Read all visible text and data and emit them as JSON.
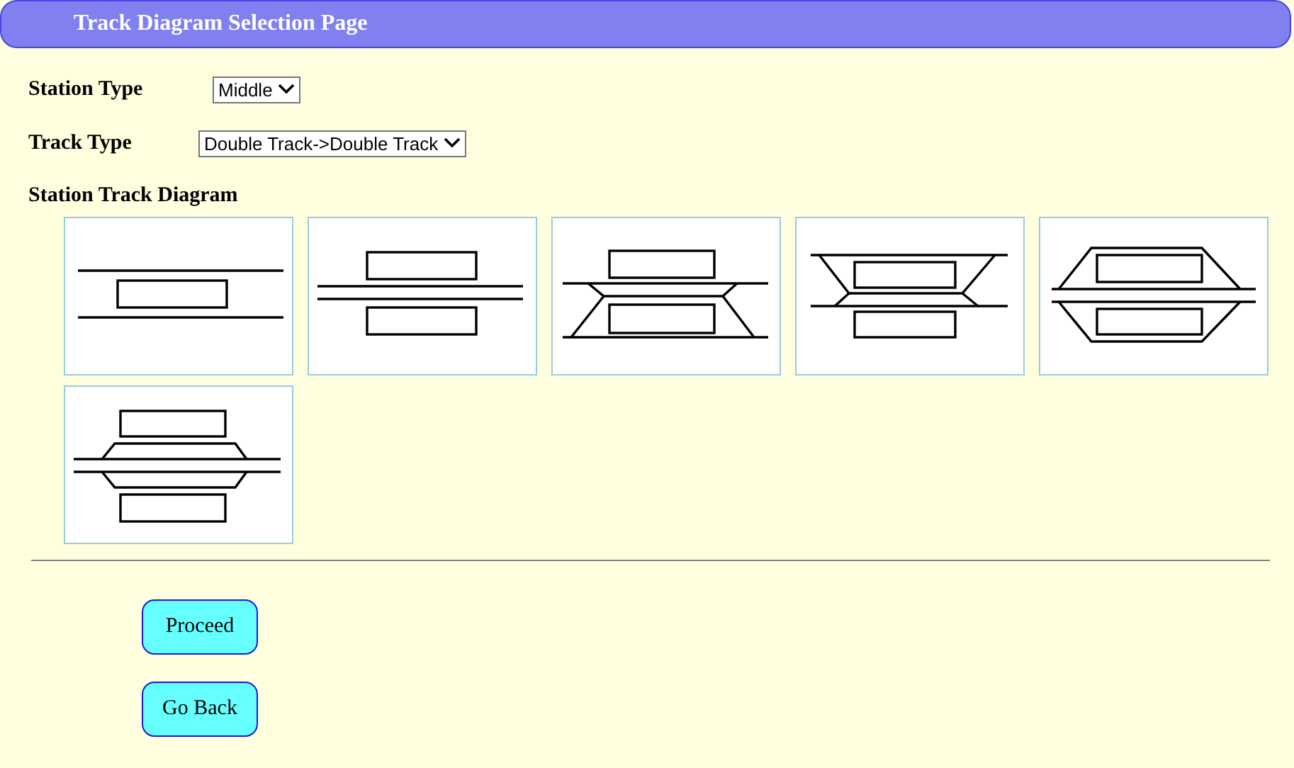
{
  "header": {
    "title": "Track Diagram Selection Page"
  },
  "fields": [
    {
      "label": "Station Type",
      "value": "Middle"
    },
    {
      "label": "Track Type",
      "value": "Double Track->Double Track"
    }
  ],
  "diagram_section": {
    "title": "Station Track Diagram",
    "diagrams": [
      {
        "kind": "single-island"
      },
      {
        "kind": "double-main"
      },
      {
        "kind": "loop-below"
      },
      {
        "kind": "loop-between"
      },
      {
        "kind": "loop-outer"
      },
      {
        "kind": "loop-inner"
      }
    ]
  },
  "buttons": [
    {
      "label": "Proceed"
    },
    {
      "label": "Go Back"
    }
  ]
}
